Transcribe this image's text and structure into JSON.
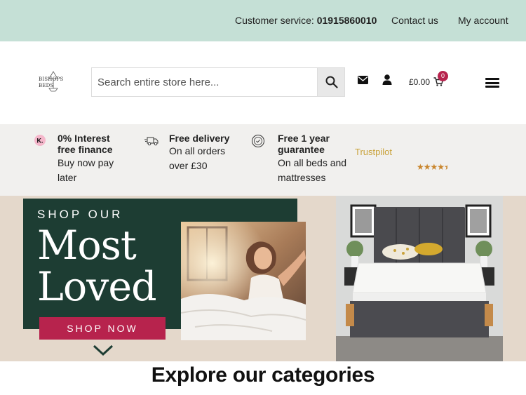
{
  "topbar": {
    "customer_service_label": "Customer service:",
    "customer_service_phone": "01915860010",
    "contact_label": "Contact us",
    "account_label": "My account"
  },
  "header": {
    "logo_line1": "BISHOPS",
    "logo_line2": "BEDS",
    "search_placeholder": "Search entire store here...",
    "cart_total": "£0.00",
    "cart_count": "0",
    "icons": [
      "search-icon",
      "envelope-icon",
      "user-icon",
      "cart-icon",
      "menu-icon"
    ]
  },
  "usp": [
    {
      "title": "0% Interest free finance",
      "text": "Buy now pay later",
      "icon": "klarna-icon"
    },
    {
      "title": "Free delivery",
      "text": "On all orders over £30",
      "icon": "truck-icon"
    },
    {
      "title": "Free 1 year guarantee",
      "text": "On all beds and mattresses",
      "icon": "guarantee-icon"
    }
  ],
  "trustpilot": {
    "label": "Trustpilot",
    "rating": 4.5
  },
  "hero": {
    "line1": "SHOP OUR",
    "line2": "Most",
    "line3": "Loved",
    "cta": "SHOP NOW"
  },
  "section_title": "Explore our categories",
  "colors": {
    "topbar": "#c5e0d6",
    "accent": "#b7234d",
    "promo_bg": "#1d3d33",
    "hero_bg": "#e4d8cb",
    "usp_bg": "#f1f0ee",
    "trustpilot": "#c9a23a"
  }
}
